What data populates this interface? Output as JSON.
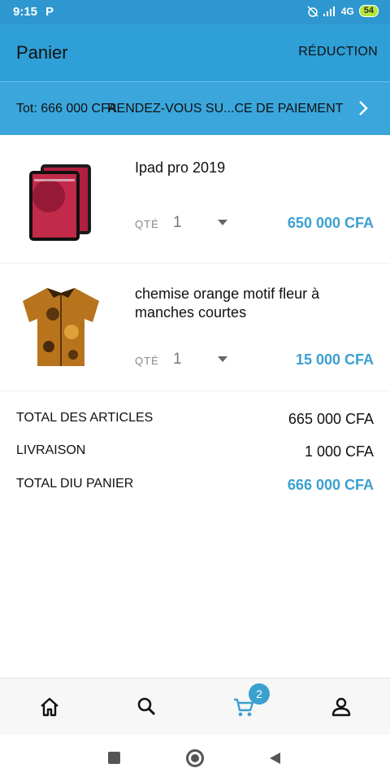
{
  "status_bar": {
    "time": "9:15",
    "p_icon": "P",
    "network": "4G",
    "battery": "54"
  },
  "app_bar": {
    "title": "Panier",
    "discount_label": "RÉDUCTION"
  },
  "checkout_bar": {
    "total": "Tot: 666 000 CFA",
    "label": "RENDEZ-VOUS SU...CE DE PAIEMENT"
  },
  "cart": {
    "items": [
      {
        "name": "Ipad pro 2019",
        "qty_label": "QTÉ",
        "qty": "1",
        "price": "650 000 CFA",
        "image_icon": "ipad-product-image"
      },
      {
        "name": "chemise orange motif fleur à manches courtes",
        "qty_label": "QTÉ",
        "qty": "1",
        "price": "15 000 CFA",
        "image_icon": "shirt-product-image"
      }
    ]
  },
  "summary": {
    "articles_label": "TOTAL DES ARTICLES",
    "articles_value": "665 000 CFA",
    "delivery_label": "LIVRAISON",
    "delivery_value": "1 000 CFA",
    "total_label": "TOTAL DIU PANIER",
    "total_value": "666 000 CFA"
  },
  "bottom_nav": {
    "cart_badge": "2",
    "items": [
      "home-icon",
      "search-icon",
      "cart-icon",
      "account-icon"
    ]
  },
  "colors": {
    "primary": "#2e9fd7",
    "accent": "#3aa0cf"
  }
}
